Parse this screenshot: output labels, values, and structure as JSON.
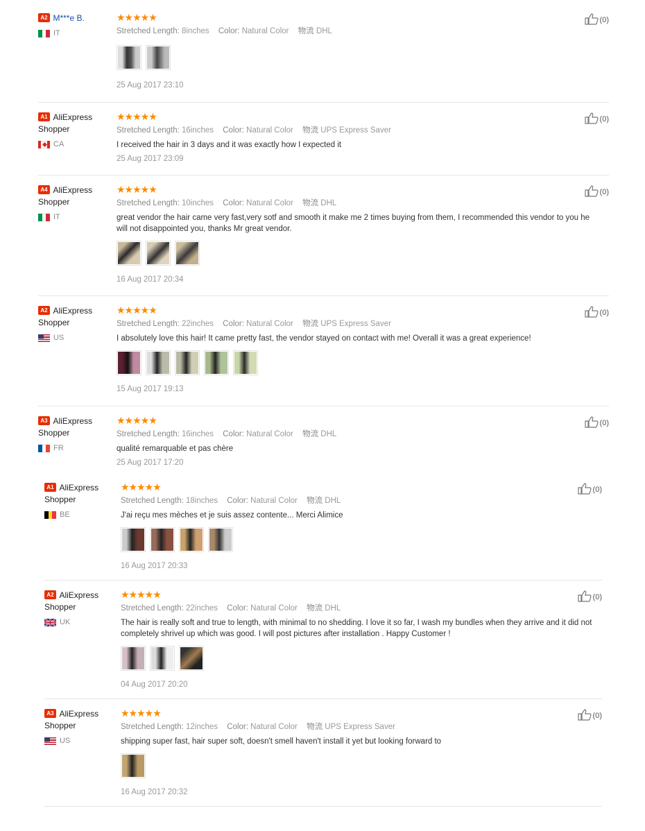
{
  "like_count_label": "(0)",
  "stars": "★★★★★",
  "attr_labels": {
    "length": "Stretched Length:",
    "color": "Color:",
    "shipping": "物流"
  },
  "reviews": [
    {
      "badge": "A2",
      "name": "M***e B.",
      "name2": "",
      "country": "IT",
      "flag": "it",
      "length": "8inches",
      "color": "Natural Color",
      "shipping": "DHL",
      "text": "",
      "date": "25 Aug 2017 23:10"
    },
    {
      "badge": "A1",
      "name": "AliExpress",
      "name2": "Shopper",
      "country": "CA",
      "flag": "ca",
      "length": "16inches",
      "color": "Natural Color",
      "shipping": "UPS Express Saver",
      "text": "I received the hair in 3 days and it was exactly how I expected it",
      "date": "25 Aug 2017 23:09"
    },
    {
      "badge": "A4",
      "name": "AliExpress",
      "name2": "Shopper",
      "country": "IT",
      "flag": "it",
      "length": "10inches",
      "color": "Natural Color",
      "shipping": "DHL",
      "text": "great vendor the hair came very fast,very sotf and smooth it make me 2 times buying from them, I recommended this vendor to you he will not disappointed you, thanks Mr great vendor.",
      "date": "16 Aug 2017 20:34"
    },
    {
      "badge": "A2",
      "name": "AliExpress",
      "name2": "Shopper",
      "country": "US",
      "flag": "us",
      "length": "22inches",
      "color": "Natural Color",
      "shipping": "UPS Express Saver",
      "text": "I absolutely love this hair! It came pretty fast, the vendor stayed on contact with me! Overall it was a great experience!",
      "date": "15 Aug 2017 19:13"
    },
    {
      "badge": "A3",
      "name": "AliExpress",
      "name2": "Shopper",
      "country": "FR",
      "flag": "fr",
      "length": "16inches",
      "color": "Natural Color",
      "shipping": "DHL",
      "text": "qualité remarquable et pas chère",
      "date": "25 Aug 2017 17:20"
    },
    {
      "badge": "A1",
      "name": "AliExpress",
      "name2": "Shopper",
      "country": "BE",
      "flag": "be",
      "length": "18inches",
      "color": "Natural Color",
      "shipping": "DHL",
      "text": "J'ai reçu mes mèches et je suis assez contente... Merci Alimice",
      "date": "16 Aug 2017 20:33"
    },
    {
      "badge": "A2",
      "name": "AliExpress",
      "name2": "Shopper",
      "country": "UK",
      "flag": "uk",
      "length": "22inches",
      "color": "Natural Color",
      "shipping": "DHL",
      "text": "The hair is really soft and true to length, with minimal to no shedding. I love it so far, I wash my bundles when they arrive and it did not completely shrivel up which was good. I will post pictures after installation . Happy Customer !",
      "date": "04 Aug 2017 20:20"
    },
    {
      "badge": "A3",
      "name": "AliExpress",
      "name2": "Shopper",
      "country": "US",
      "flag": "us",
      "length": "12inches",
      "color": "Natural Color",
      "shipping": "UPS Express Saver",
      "text": "shipping super fast, hair super soft, doesn't smell haven't install it yet but looking forward to",
      "date": "16 Aug 2017 20:32"
    }
  ],
  "colors": {
    "badge": "#e62e04",
    "stars": "#ff8a00",
    "link": "#1a4ea7",
    "muted": "#999999"
  }
}
